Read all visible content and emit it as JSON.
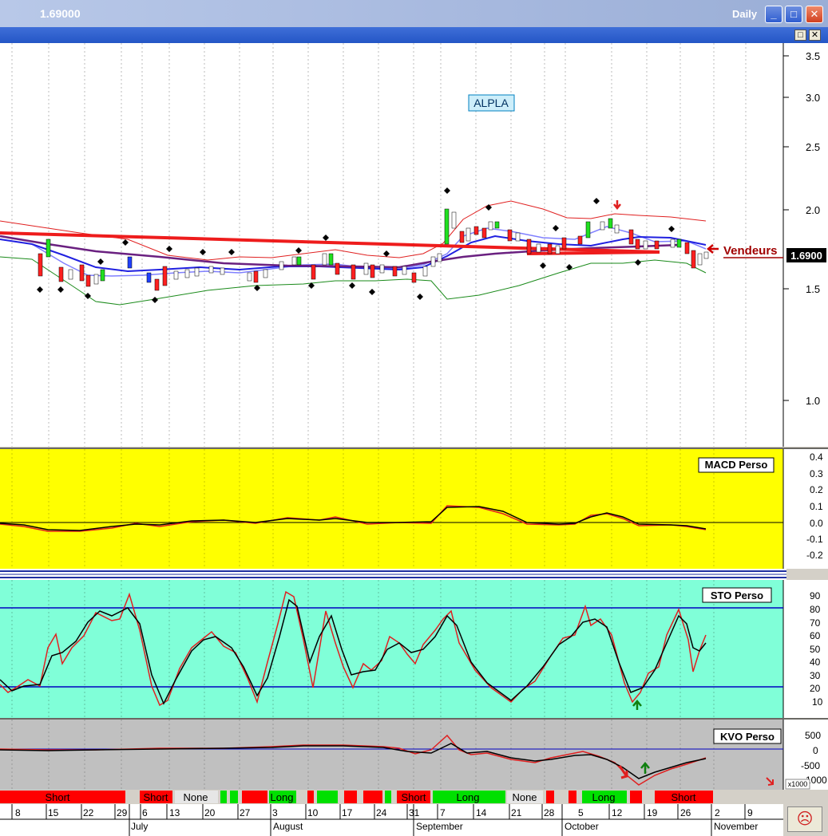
{
  "window": {
    "title": "1.69000",
    "period": "Daily",
    "min_btn": "_",
    "max_btn": "□",
    "close_btn": "✕"
  },
  "inner": {
    "restore_btn": "□",
    "close_btn": "✕"
  },
  "main_chart": {
    "symbol": "ALPLA",
    "price_ticks": [
      "3.5",
      "3.0",
      "2.5",
      "2.0",
      "1.5",
      "1.0"
    ],
    "last_price": "1.6900",
    "annotation": "Vendeurs"
  },
  "macd": {
    "label": "MACD Perso",
    "ticks": [
      "0.4",
      "0.3",
      "0.2",
      "0.1",
      "0.0",
      "-0.1",
      "-0.2"
    ]
  },
  "sto": {
    "label": "STO Perso",
    "ticks": [
      "90",
      "80",
      "70",
      "60",
      "50",
      "40",
      "30",
      "20",
      "10"
    ]
  },
  "kvo": {
    "label": "KVO Perso",
    "ticks": [
      "500",
      "0",
      "-500",
      "-1000"
    ],
    "multiplier": "x1000"
  },
  "signals": [
    {
      "label": "Short",
      "color": "#ff0000"
    },
    {
      "label": "Short",
      "color": "#ff0000"
    },
    {
      "label": "None",
      "color": "#d4d0c8"
    },
    {
      "label": "Long",
      "color": "#00e000"
    },
    {
      "label": "Short",
      "color": "#ff0000"
    },
    {
      "label": "Long",
      "color": "#00e000"
    },
    {
      "label": "None",
      "color": "#d4d0c8"
    },
    {
      "label": "Long",
      "color": "#00e000"
    },
    {
      "label": "Short",
      "color": "#ff0000"
    }
  ],
  "date_axis": {
    "days": [
      "8",
      "15",
      "22",
      "29",
      "6",
      "13",
      "20",
      "27",
      "3",
      "10",
      "17",
      "24",
      "31",
      "7",
      "14",
      "21",
      "28",
      "5",
      "12",
      "19",
      "26",
      "2",
      "9"
    ],
    "months": [
      "July",
      "August",
      "September",
      "October",
      "November"
    ]
  },
  "status_icon": "☹"
}
